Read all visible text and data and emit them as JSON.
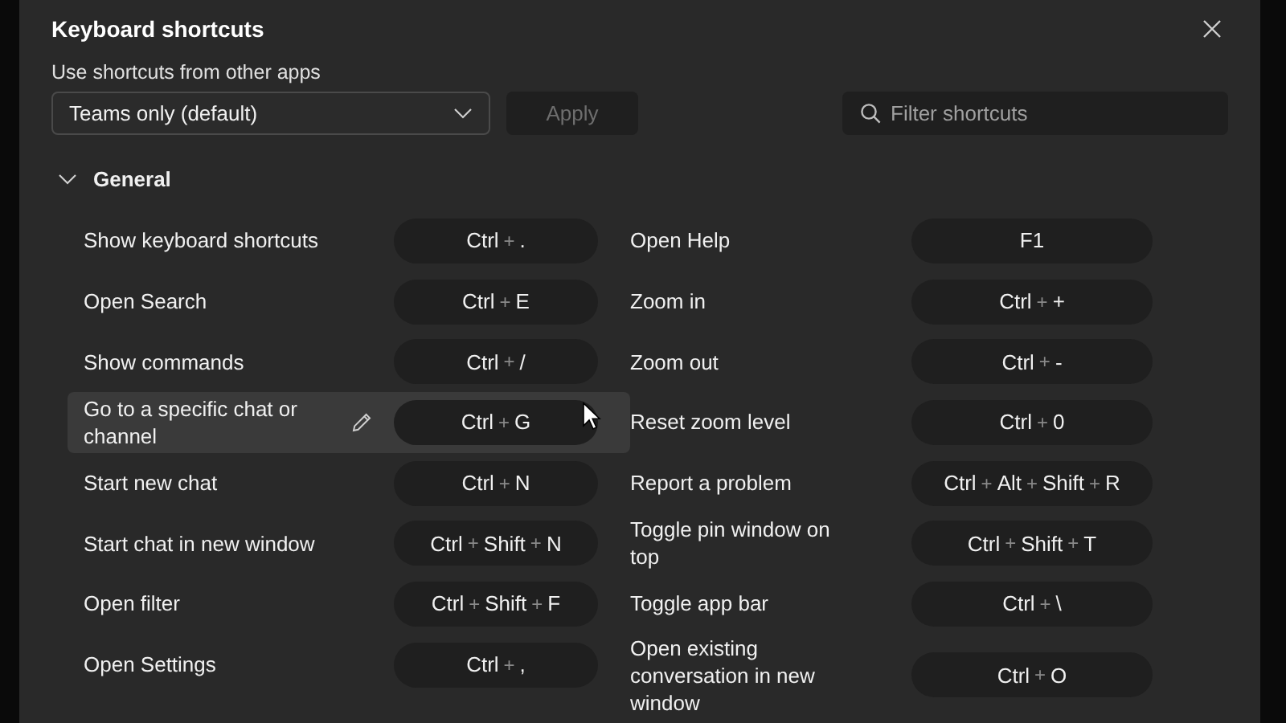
{
  "dialog": {
    "title": "Keyboard shortcuts"
  },
  "app_shortcuts": {
    "label": "Use shortcuts from other apps",
    "dropdown": {
      "value": "Teams only (default)"
    },
    "apply_button": {
      "label": "Apply",
      "disabled": true
    }
  },
  "search": {
    "placeholder": "Filter shortcuts"
  },
  "section": {
    "title": "General",
    "expanded": true,
    "separator": "+",
    "columns": [
      [
        {
          "label": "Show keyboard shortcuts",
          "keys": [
            "Ctrl",
            "."
          ],
          "hovered": false
        },
        {
          "label": "Open Search",
          "keys": [
            "Ctrl",
            "E"
          ],
          "hovered": false
        },
        {
          "label": "Show commands",
          "keys": [
            "Ctrl",
            "/"
          ],
          "hovered": false
        },
        {
          "label": "Go to a specific chat or channel",
          "keys": [
            "Ctrl",
            "G"
          ],
          "hovered": true
        },
        {
          "label": "Start new chat",
          "keys": [
            "Ctrl",
            "N"
          ],
          "hovered": false
        },
        {
          "label": "Start chat in new window",
          "keys": [
            "Ctrl",
            "Shift",
            "N"
          ],
          "hovered": false
        },
        {
          "label": "Open filter",
          "keys": [
            "Ctrl",
            "Shift",
            "F"
          ],
          "hovered": false
        },
        {
          "label": "Open Settings",
          "keys": [
            "Ctrl",
            ","
          ],
          "hovered": false
        }
      ],
      [
        {
          "label": "Open Help",
          "keys": [
            "F1"
          ],
          "hovered": false
        },
        {
          "label": "Zoom in",
          "keys": [
            "Ctrl",
            "+"
          ],
          "hovered": false
        },
        {
          "label": "Zoom out",
          "keys": [
            "Ctrl",
            "-"
          ],
          "hovered": false
        },
        {
          "label": "Reset zoom level",
          "keys": [
            "Ctrl",
            "0"
          ],
          "hovered": false
        },
        {
          "label": "Report a problem",
          "keys": [
            "Ctrl",
            "Alt",
            "Shift",
            "R"
          ],
          "hovered": false
        },
        {
          "label": "Toggle pin window on top",
          "keys": [
            "Ctrl",
            "Shift",
            "T"
          ],
          "hovered": false
        },
        {
          "label": "Toggle app bar",
          "keys": [
            "Ctrl",
            "\\"
          ],
          "hovered": false
        },
        {
          "label": "Open existing conversation in new window",
          "keys": [
            "Ctrl",
            "O"
          ],
          "hovered": false
        }
      ]
    ]
  }
}
